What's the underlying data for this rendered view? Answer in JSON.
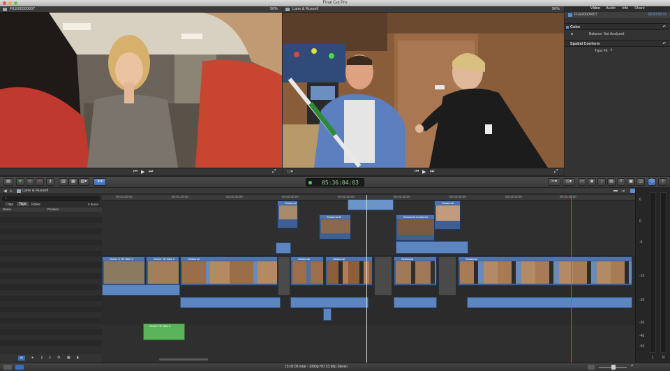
{
  "app": {
    "title": "Final Cut Pro"
  },
  "viewer_left": {
    "name": "FILE00000007",
    "zoom": "56%"
  },
  "viewer_right": {
    "name": "Lane & Russell",
    "zoom": "56%"
  },
  "inspector": {
    "tabs": [
      "Video",
      "Audio",
      "Info",
      "Share"
    ],
    "clip_name": "FILE00000007",
    "timecode": "00:00:52:07",
    "color_section": "Color",
    "balance_label": "Balance:",
    "balance_value": "Not Analyzed",
    "spatial_section": "Spatial Conform",
    "type_label": "Type:",
    "type_value": "Fit"
  },
  "toolbar": {
    "timecode": "05:36:04:03"
  },
  "timeline": {
    "project_name": "Lane & Russell",
    "ruler": [
      "00:01:00:00",
      "00:01:20:00",
      "00:01:40:00",
      "00:02:00:00",
      "00:02:20:00",
      "00:02:40:00",
      "00:03:00:00",
      "00:03:20:00",
      "00:03:40:00"
    ],
    "clip_labels": {
      "scene6a": "Scene 6 7B Take 4",
      "scene7b": "Scene 7B Take 3",
      "seasonal1": "Seasonal",
      "seasonal2": "Seasonal",
      "seasonal3": "Seasonal",
      "seasonal4": "Seasonal",
      "seasonal5": "Seasonal",
      "conn1": "Seasonal",
      "conn2": "Seasonal Customer",
      "conn3": "Seasonal B",
      "green": "Scene 7B Take 2"
    }
  },
  "index": {
    "tabs": [
      "Clips",
      "Tags",
      "Roles"
    ],
    "items_count": "0 Items",
    "col_name": "Name",
    "col_position": "Position"
  },
  "meters": {
    "labels": [
      "6",
      "0",
      "-6",
      "-12",
      "-20",
      "-30",
      "-40",
      "-50"
    ],
    "channels": [
      "L",
      "R"
    ]
  },
  "status": {
    "text": "15:02:06 total - 1080p HD 23.98p Stereo"
  }
}
